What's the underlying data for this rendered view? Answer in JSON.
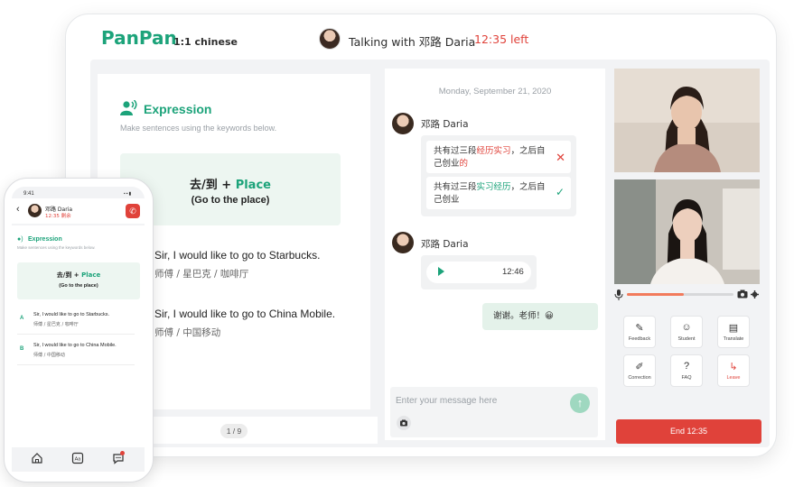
{
  "brand": {
    "name": "PanPan",
    "subtitle": "1:1 chinese"
  },
  "header": {
    "talking_with": "Talking with 邓路 Daria",
    "time_left": "12:35 left"
  },
  "lesson": {
    "section_title": "Expression",
    "section_subtitle": "Make sentences using the keywords below.",
    "keyword_cn": "去/到 + ",
    "keyword_place": "Place",
    "keyword_en": "(Go to the place)",
    "options": [
      {
        "letter": "A",
        "en": "Sir, I would like to go to Starbucks.",
        "cn": "师傅 / 星巴克 / 咖啡厅"
      },
      {
        "letter": "B",
        "en": "Sir, I would like to go to China Mobile.",
        "cn": "师傅 / 中国移动"
      }
    ],
    "pager": "1 / 9"
  },
  "chat": {
    "date": "Monday, September 21, 2020",
    "sender": "邓路 Daria",
    "correction": {
      "wrong_pre": "共有过三段",
      "wrong_hl": "经历实习",
      "wrong_mid": "，之后自己创业",
      "wrong_end": "的",
      "right_pre": "共有过三段",
      "right_hl": "实习经历",
      "right_post": "，之后自己创业"
    },
    "voice_duration": "12:46",
    "my_message": "谢谢。老师！😀",
    "input_placeholder": "Enter your message here"
  },
  "tools": {
    "row1": [
      "Feedback",
      "Student",
      "Translate"
    ],
    "row2": [
      "Correction",
      "FAQ",
      "Leave"
    ]
  },
  "volume_level": 0.53,
  "end_button": "End 12:35",
  "phone": {
    "status_time": "9:41",
    "name": "邓路 Daria",
    "time_left": "12:35 剩余",
    "section_title": "Expression",
    "section_subtitle": "Make sentences using the keywords below.",
    "keyword_cn": "去/到 + ",
    "keyword_place": "Place",
    "keyword_en": "(Go to the place)",
    "options": [
      {
        "letter": "A",
        "en": "Sir, I would like to go to Starbucks.",
        "cn": "师傅 / 星巴克 / 咖啡厅"
      },
      {
        "letter": "B",
        "en": "Sir, I would like to go to China Mobile.",
        "cn": "师傅 / 中国移动"
      }
    ],
    "tab_icons": [
      "home-icon",
      "dictionary-icon",
      "chat-icon"
    ]
  },
  "colors": {
    "brand_green": "#1ca37a",
    "alert_red": "#e0423a",
    "card_green": "#edf6f1"
  }
}
